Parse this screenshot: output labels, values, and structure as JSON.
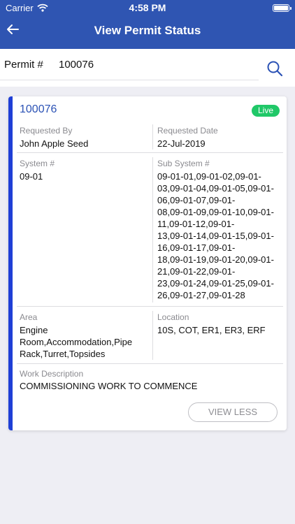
{
  "status_bar": {
    "carrier": "Carrier",
    "time": "4:58 PM",
    "battery_level": 1.0
  },
  "nav": {
    "title": "View Permit Status",
    "back_icon": "back-arrow-icon"
  },
  "search": {
    "label": "Permit #",
    "value": "100076",
    "icon": "search-icon"
  },
  "permit": {
    "number": "100076",
    "status": "Live",
    "status_color": "#20c868",
    "accent_color": "#1f3fd6",
    "requested_by_label": "Requested By",
    "requested_by": "John Apple Seed",
    "requested_date_label": "Requested Date",
    "requested_date": "22-Jul-2019",
    "system_label": "System #",
    "system": "09-01",
    "subsystem_label": "Sub System #",
    "subsystem_lines": [
      "09-01-01,09-01-02,09-01-",
      "03,09-01-04,09-01-05,09-01-",
      "06,09-01-07,09-01-",
      "08,09-01-09,09-01-10,09-01-",
      "11,09-01-12,09-01-",
      "13,09-01-14,09-01-15,09-01-",
      "16,09-01-17,09-01-",
      "18,09-01-19,09-01-20,09-01-",
      "21,09-01-22,09-01-",
      "23,09-01-24,09-01-25,09-01-",
      "26,09-01-27,09-01-28"
    ],
    "area_label": "Area",
    "area_lines": [
      "Engine",
      "Room,Accommodation,Pipe",
      "Rack,Turret,Topsides"
    ],
    "location_label": "Location",
    "location": "10S, COT, ER1, ER3, ERF",
    "work_description_label": "Work Description",
    "work_description": "COMMISSIONING WORK TO COMMENCE",
    "view_less_label": "VIEW LESS"
  }
}
